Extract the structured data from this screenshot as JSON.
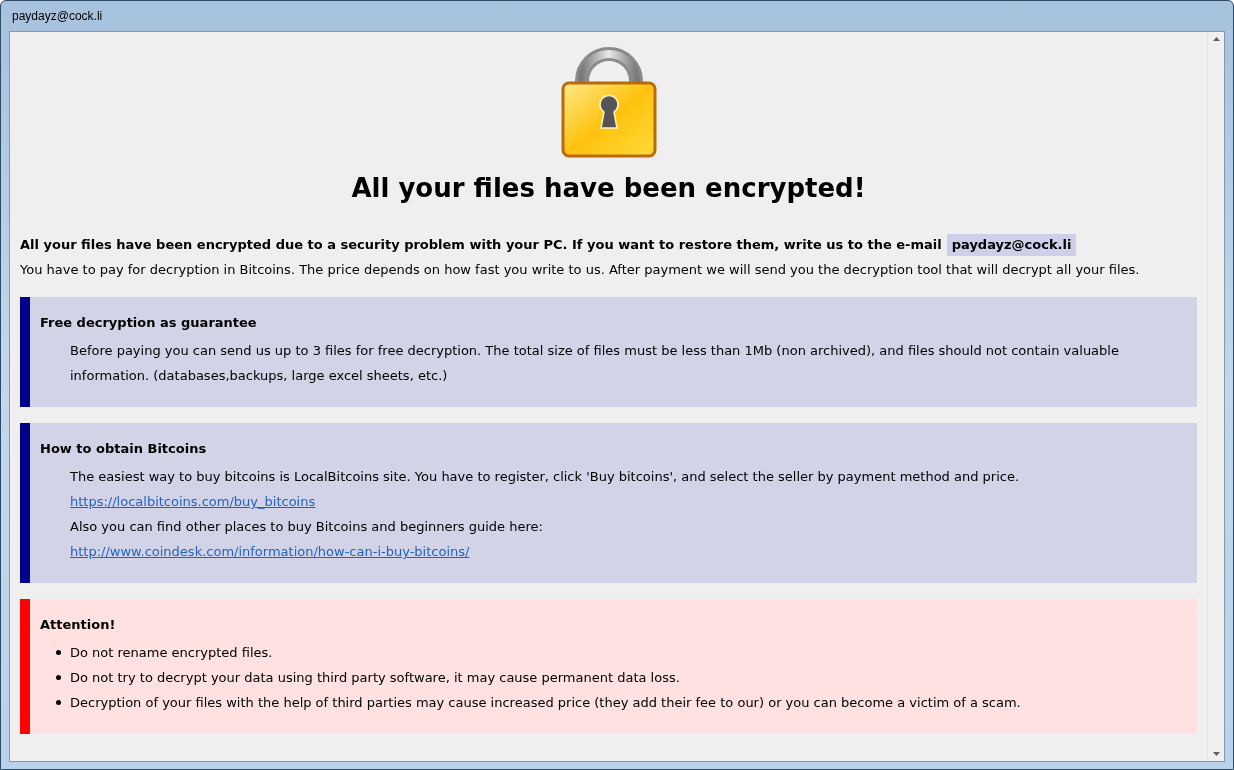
{
  "window": {
    "title": "paydayz@cock.li"
  },
  "heading": "All your files have been encrypted!",
  "intro": {
    "lead": "All your files have been encrypted due to a security problem with your PC. If you want to restore them, write us to the e-mail",
    "email": "paydayz@cock.li",
    "text": "You have to pay for decryption in Bitcoins. The price depends on how fast you write to us. After payment we will send you the decryption tool that will decrypt all your files."
  },
  "sections": [
    {
      "kind": "info",
      "title": "Free decryption as guarantee",
      "lines": [
        {
          "kind": "text",
          "text": "Before paying you can send us up to 3 files for free decryption. The total size of files must be less than 1Mb (non archived), and files should not contain valuable information. (databases,backups, large excel sheets, etc.)"
        }
      ]
    },
    {
      "kind": "info",
      "title": "How to obtain Bitcoins",
      "lines": [
        {
          "kind": "text",
          "text": "The easiest way to buy bitcoins is LocalBitcoins site. You have to register, click 'Buy bitcoins', and select the seller by payment method and price."
        },
        {
          "kind": "link",
          "text": "https://localbitcoins.com/buy_bitcoins"
        },
        {
          "kind": "text",
          "text": "Also you can find other places to buy Bitcoins and beginners guide here:"
        },
        {
          "kind": "link",
          "text": "http://www.coindesk.com/information/how-can-i-buy-bitcoins/"
        }
      ]
    },
    {
      "kind": "warning",
      "title": "Attention!",
      "lines": [
        {
          "kind": "bullet",
          "text": "Do not rename encrypted files."
        },
        {
          "kind": "bullet",
          "text": "Do not try to decrypt your data using third party software, it may cause permanent data loss."
        },
        {
          "kind": "bullet",
          "text": "Decryption of your files with the help of third parties may cause increased price (they add their fee to our) or you can become a victim of a scam."
        }
      ]
    }
  ]
}
